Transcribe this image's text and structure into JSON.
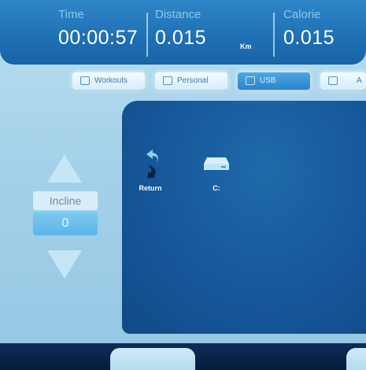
{
  "stats": {
    "time": {
      "label": "Time",
      "value": "00:00:57"
    },
    "distance": {
      "label": "Distance",
      "value": "0.015",
      "unit": "Km"
    },
    "calorie": {
      "label": "Calorie",
      "value": "0.015"
    }
  },
  "tabs": [
    {
      "label": "Workouts",
      "active": false
    },
    {
      "label": "Personal",
      "active": false
    },
    {
      "label": "USB",
      "active": true
    },
    {
      "label": "A",
      "active": false
    }
  ],
  "incline": {
    "label": "Incline",
    "value": "0"
  },
  "files": [
    {
      "label": "Return",
      "icon": "return-arrow-icon"
    },
    {
      "label": "C:",
      "icon": "drive-icon"
    }
  ],
  "colors": {
    "header": "#1f6fb4",
    "panel": "#16579a",
    "background": "#a6d2ea",
    "active_tab": "#2a84c7"
  }
}
